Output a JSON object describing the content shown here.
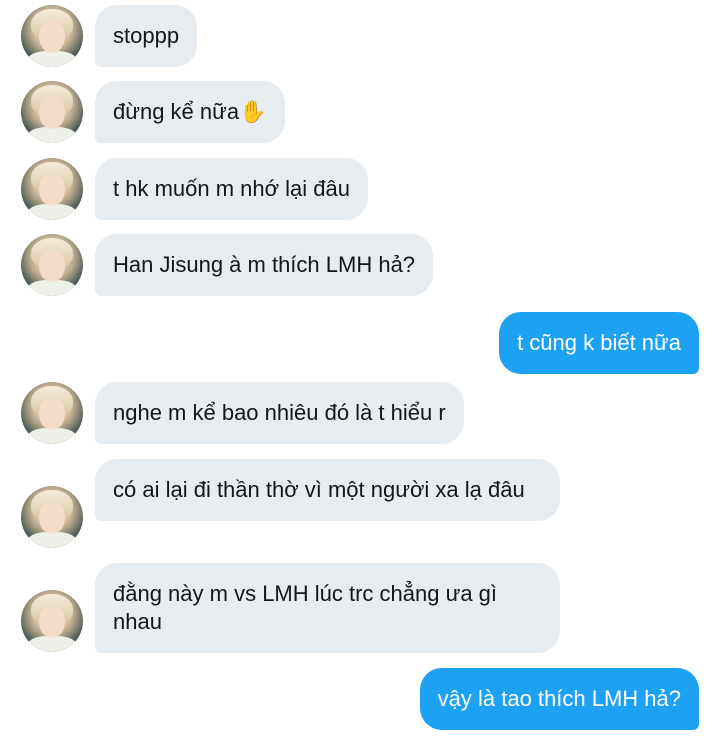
{
  "messages": [
    {
      "side": "in",
      "text": "stoppp"
    },
    {
      "side": "in",
      "text": "đừng kể nữa",
      "emoji": "✋",
      "emoji_icon": "raised-hand-icon"
    },
    {
      "side": "in",
      "text": "t hk muốn m nhớ lại đâu"
    },
    {
      "side": "in",
      "text": "Han Jisung à m thích LMH hả?"
    },
    {
      "side": "out",
      "text": "t cũng k biết nữa"
    },
    {
      "side": "in",
      "text": "nghe m kể bao nhiêu đó là t hiểu r"
    },
    {
      "side": "in",
      "text": "có ai lại đi thần thờ vì một người xa lạ đâu"
    },
    {
      "side": "in",
      "text": "đằng này m vs LMH lúc trc chẳng ưa gì nhau"
    },
    {
      "side": "out",
      "text": "vậy là tao thích LMH hả?"
    }
  ],
  "colors": {
    "incoming_bubble": "#e6ecf0",
    "outgoing_bubble": "#1da1f2",
    "incoming_text": "#14171a",
    "outgoing_text": "#ffffff"
  }
}
